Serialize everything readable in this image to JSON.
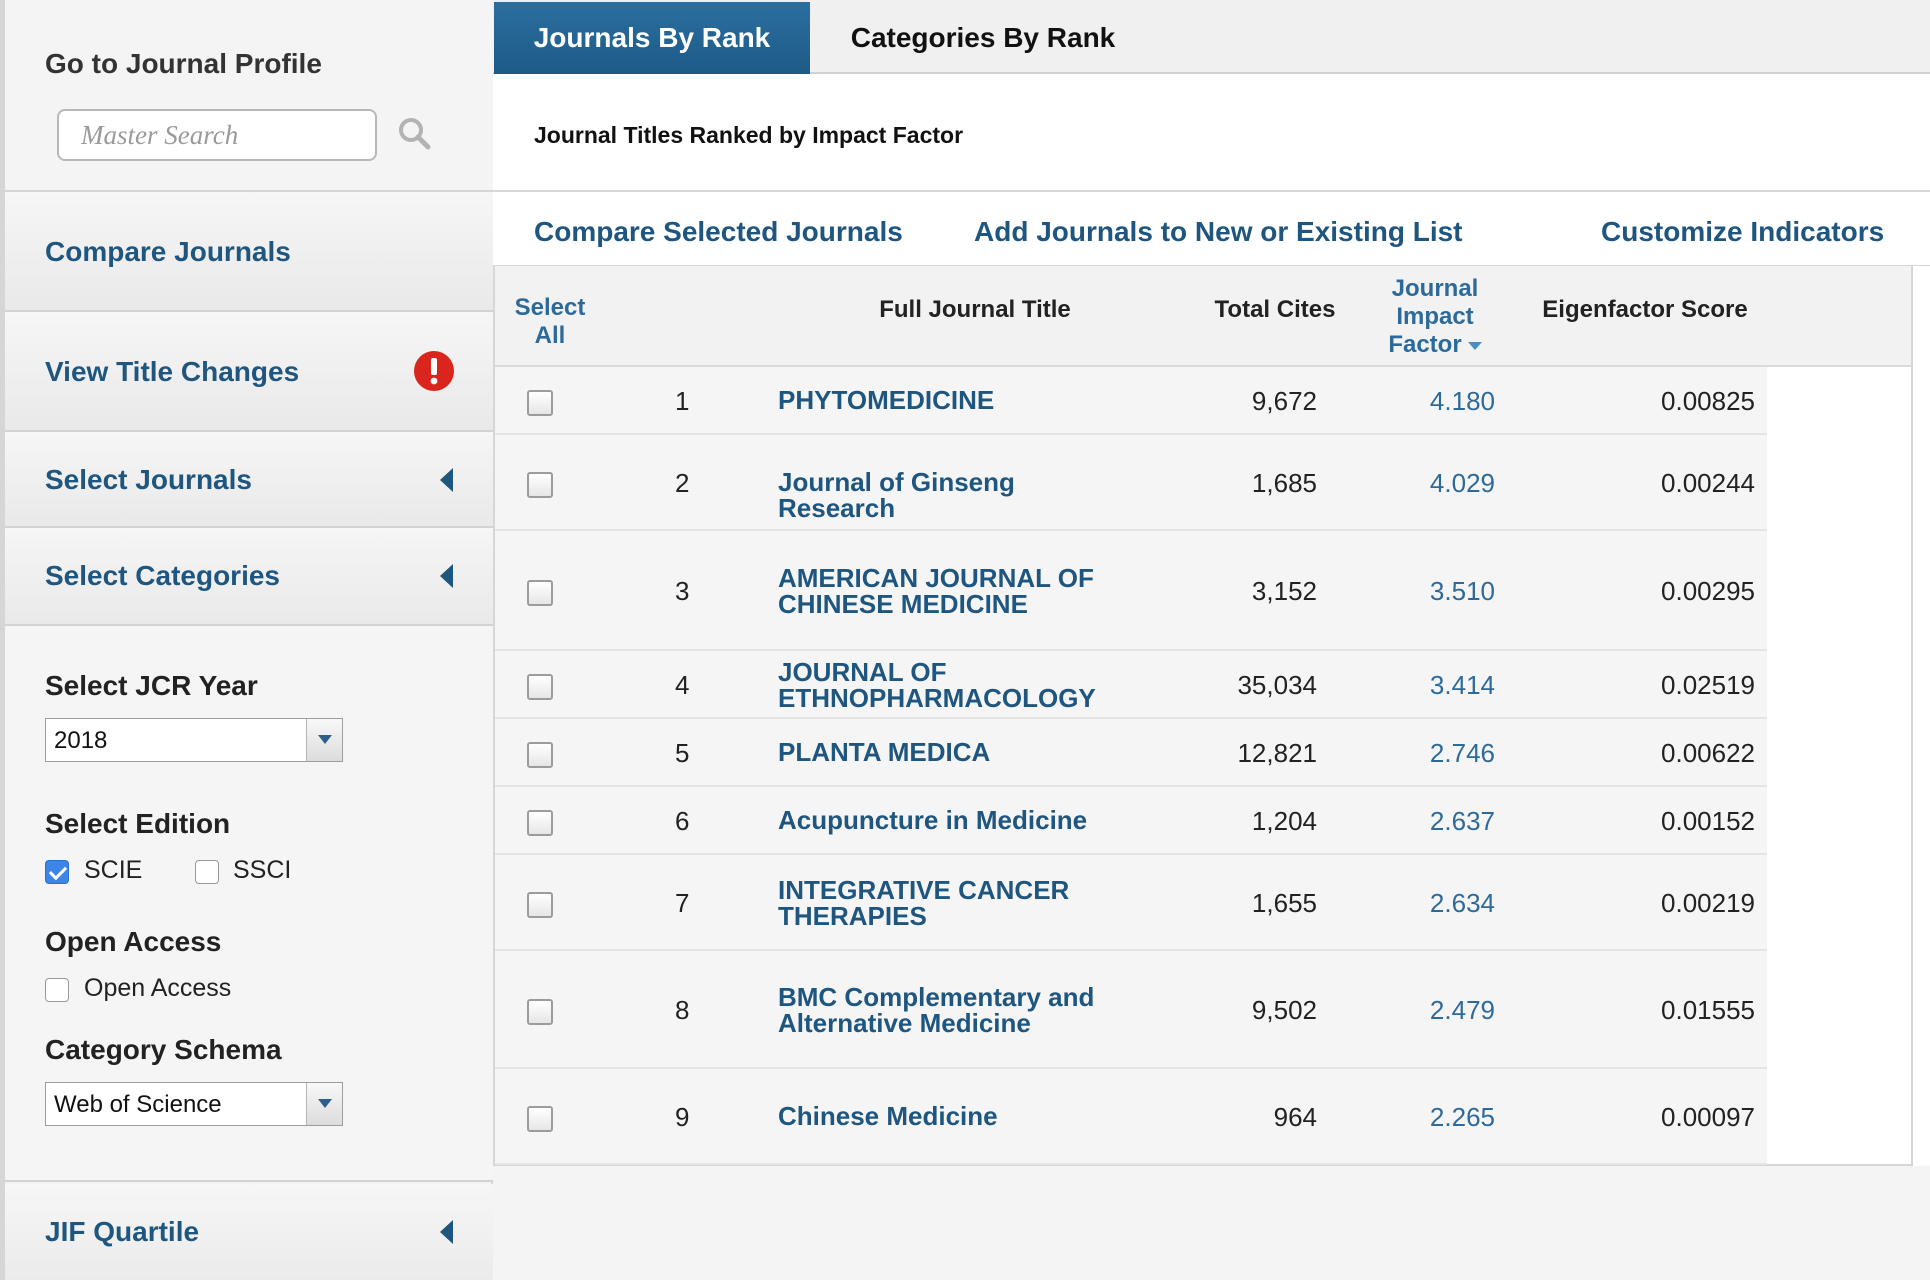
{
  "sidebar": {
    "profile_heading": "Go to Journal Profile",
    "search_placeholder": "Master Search",
    "compare_journals": "Compare Journals",
    "view_title_changes": "View Title Changes",
    "select_journals": "Select Journals",
    "select_categories": "Select Categories",
    "jcr_year_heading": "Select JCR Year",
    "jcr_year_value": "2018",
    "edition_heading": "Select Edition",
    "edition_scie": "SCIE",
    "edition_ssci": "SSCI",
    "open_access_heading": "Open Access",
    "open_access_label": "Open Access",
    "schema_heading": "Category Schema",
    "schema_value": "Web of Science",
    "jif_quartile": "JIF Quartile"
  },
  "tabs": {
    "journals_by_rank": "Journals By Rank",
    "categories_by_rank": "Categories By Rank"
  },
  "main": {
    "ranked_title": "Journal Titles Ranked by Impact Factor",
    "action_compare": "Compare Selected Journals",
    "action_add": "Add Journals to New or Existing List",
    "action_customize": "Customize Indicators"
  },
  "table": {
    "headers": {
      "select_all_1": "Select",
      "select_all_2": "All",
      "title": "Full Journal Title",
      "cites": "Total Cites",
      "jif_1": "Journal",
      "jif_2": "Impact",
      "jif_3": "Factor",
      "eigen": "Eigenfactor Score"
    },
    "rows": [
      {
        "rank": "1",
        "title_1": "PHYTOMEDICINE",
        "title_2": "",
        "cites": "9,672",
        "jif": "4.180",
        "eigen": "0.00825"
      },
      {
        "rank": "2",
        "title_1": "Journal of Ginseng Research",
        "title_2": "",
        "cites": "1,685",
        "jif": "4.029",
        "eigen": "0.00244"
      },
      {
        "rank": "3",
        "title_1": "AMERICAN JOURNAL OF",
        "title_2": "CHINESE MEDICINE",
        "cites": "3,152",
        "jif": "3.510",
        "eigen": "0.00295"
      },
      {
        "rank": "4",
        "title_1": "JOURNAL OF",
        "title_2": "ETHNOPHARMACOLOGY",
        "cites": "35,034",
        "jif": "3.414",
        "eigen": "0.02519"
      },
      {
        "rank": "5",
        "title_1": "PLANTA MEDICA",
        "title_2": "",
        "cites": "12,821",
        "jif": "2.746",
        "eigen": "0.00622"
      },
      {
        "rank": "6",
        "title_1": "Acupuncture in Medicine",
        "title_2": "",
        "cites": "1,204",
        "jif": "2.637",
        "eigen": "0.00152"
      },
      {
        "rank": "7",
        "title_1": "INTEGRATIVE CANCER",
        "title_2": "THERAPIES",
        "cites": "1,655",
        "jif": "2.634",
        "eigen": "0.00219"
      },
      {
        "rank": "8",
        "title_1": "BMC Complementary and",
        "title_2": "Alternative Medicine",
        "cites": "9,502",
        "jif": "2.479",
        "eigen": "0.01555"
      },
      {
        "rank": "9",
        "title_1": "Chinese Medicine",
        "title_2": "",
        "cites": "964",
        "jif": "2.265",
        "eigen": "0.00097"
      }
    ]
  },
  "colors": {
    "link": "#1f5680",
    "tab_active": "#1d5a87",
    "alert": "#d9251d",
    "checkbox_checked": "#3d86e8"
  }
}
